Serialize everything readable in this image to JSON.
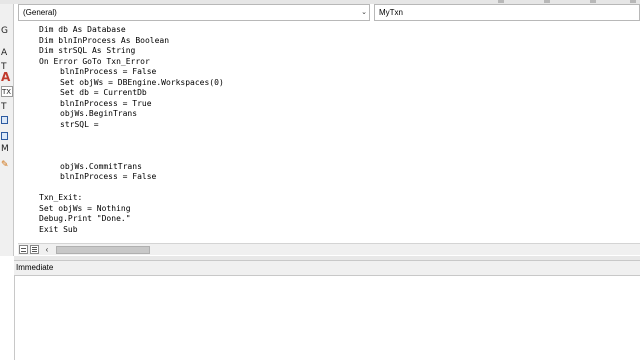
{
  "editor": {
    "object_dropdown": {
      "value": "(General)"
    },
    "procedure_dropdown": {
      "value": "MyTxn"
    },
    "code_lines": [
      "Dim db As Database",
      "Dim blnInProcess As Boolean",
      "Dim strSQL As String",
      "On Error GoTo Txn_Error",
      "blnInProcess = False",
      "Set objWs = DBEngine.Workspaces(0)",
      "Set db = CurrentDb",
      "blnInProcess = True",
      "objWs.BeginTrans",
      "strSQL =",
      "",
      "",
      "",
      "objWs.CommitTrans",
      "blnInProcess = False",
      "",
      "Txn_Exit:",
      "Set objWs = Nothing",
      "Debug.Print \"Done.\"",
      "Exit Sub"
    ]
  },
  "immediate": {
    "title": "Immediate",
    "content": ""
  },
  "left_pane": {
    "items": [
      {
        "text": "G",
        "kind": "text"
      },
      {
        "text": "A",
        "kind": "text"
      },
      {
        "text": "T",
        "kind": "text"
      },
      {
        "text": "A",
        "kind": "red"
      },
      {
        "text": "TX",
        "kind": "input"
      },
      {
        "text": "T",
        "kind": "text"
      },
      {
        "text": "",
        "kind": "blueicon"
      },
      {
        "text": "",
        "kind": "blueicon"
      },
      {
        "text": "M",
        "kind": "text"
      },
      {
        "text": "✎",
        "kind": "orange"
      }
    ]
  },
  "icons": {
    "procedure_dropdown_arrow": "chevron-down-icon",
    "object_dropdown_arrow": "chevron-down-icon",
    "scroll_left": "scroll-left-arrow-icon",
    "procedure_view": "procedure-view-icon",
    "full_module_view": "full-module-view-icon"
  },
  "colors": {
    "accent_red": "#c0392b",
    "chrome": "#f0f0f0"
  }
}
